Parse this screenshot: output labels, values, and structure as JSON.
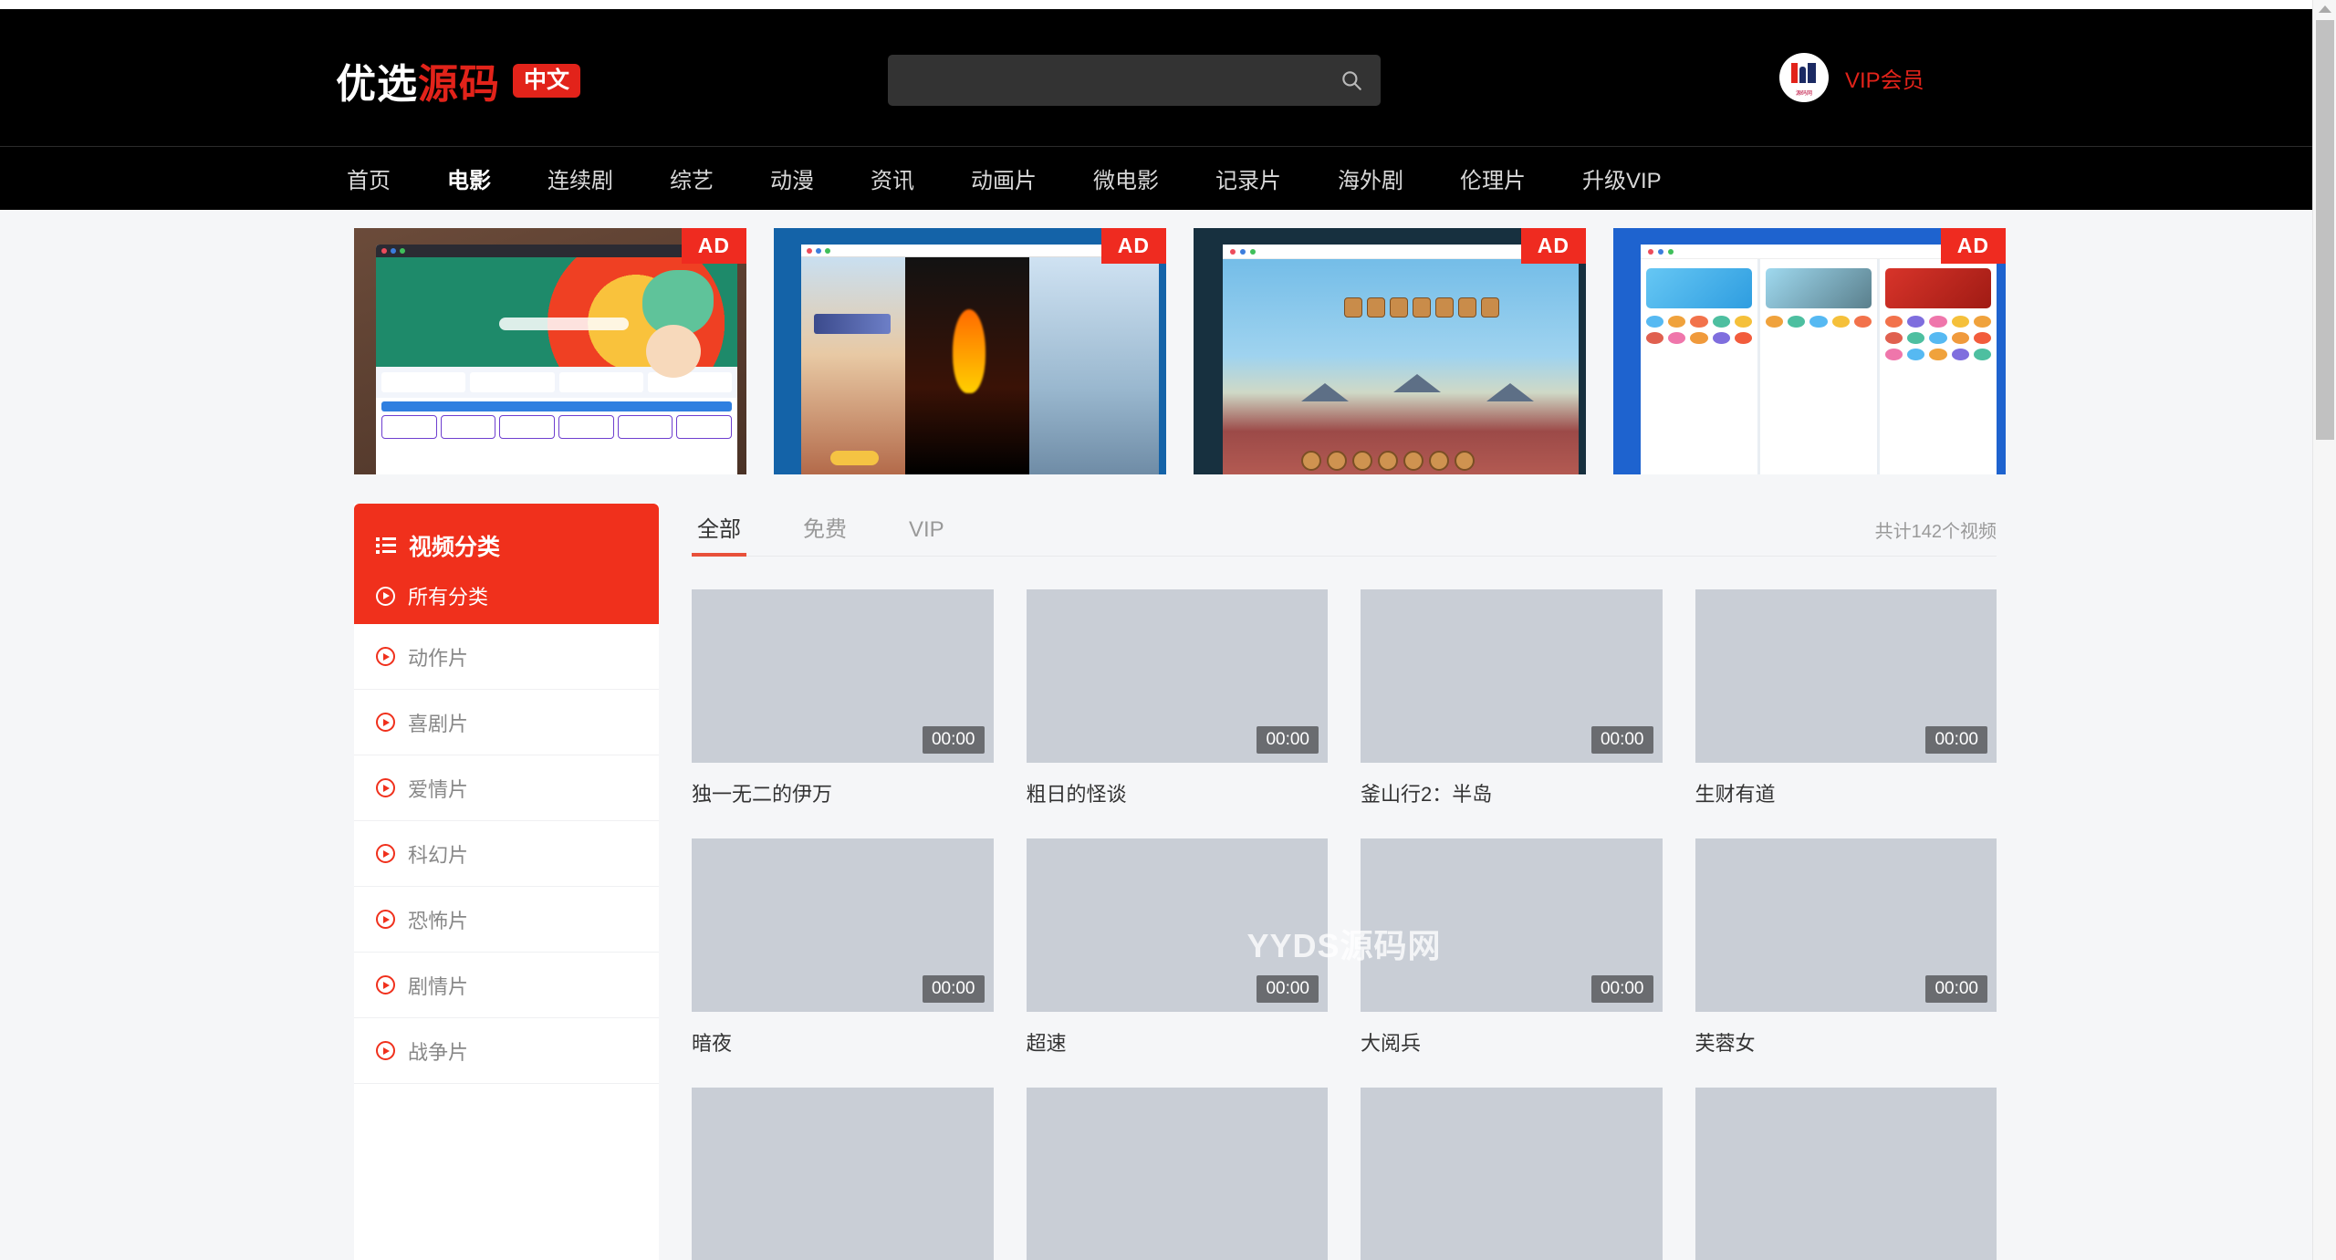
{
  "site": {
    "logo_part1": "优选",
    "logo_part2": "源码",
    "logo_badge": "中文"
  },
  "search": {
    "value": "",
    "placeholder": "",
    "icon": "search-icon"
  },
  "vip": {
    "label": "VIP会员",
    "avatar_text": "源码网"
  },
  "nav": {
    "items": [
      {
        "label": "首页",
        "active": false
      },
      {
        "label": "电影",
        "active": true
      },
      {
        "label": "连续剧",
        "active": false
      },
      {
        "label": "综艺",
        "active": false
      },
      {
        "label": "动漫",
        "active": false
      },
      {
        "label": "资讯",
        "active": false
      },
      {
        "label": "动画片",
        "active": false
      },
      {
        "label": "微电影",
        "active": false
      },
      {
        "label": "记录片",
        "active": false
      },
      {
        "label": "海外剧",
        "active": false
      },
      {
        "label": "伦理片",
        "active": false
      },
      {
        "label": "升级VIP",
        "active": false
      }
    ]
  },
  "ads": [
    {
      "badge": "AD",
      "name": "ad-banner-1"
    },
    {
      "badge": "AD",
      "name": "ad-banner-2"
    },
    {
      "badge": "AD",
      "name": "ad-banner-3"
    },
    {
      "badge": "AD",
      "name": "ad-banner-4"
    }
  ],
  "sidebar": {
    "title": "视频分类",
    "title_icon": "list-icon",
    "all_label": "所有分类",
    "items": [
      {
        "label": "动作片"
      },
      {
        "label": "喜剧片"
      },
      {
        "label": "爱情片"
      },
      {
        "label": "科幻片"
      },
      {
        "label": "恐怖片"
      },
      {
        "label": "剧情片"
      },
      {
        "label": "战争片"
      }
    ]
  },
  "main": {
    "tabs": [
      {
        "label": "全部",
        "active": true
      },
      {
        "label": "免费",
        "active": false
      },
      {
        "label": "VIP",
        "active": false
      }
    ],
    "total_text": "共计142个视频",
    "watermark": "YYDS源码网",
    "videos": [
      {
        "title": "独一无二的伊万",
        "duration": "00:00"
      },
      {
        "title": "粗日的怪谈",
        "duration": "00:00"
      },
      {
        "title": "釜山行2：半岛",
        "duration": "00:00"
      },
      {
        "title": "生财有道",
        "duration": "00:00"
      },
      {
        "title": "暗夜",
        "duration": "00:00"
      },
      {
        "title": "超速",
        "duration": "00:00"
      },
      {
        "title": "大阅兵",
        "duration": "00:00"
      },
      {
        "title": "芙蓉女",
        "duration": "00:00"
      },
      {
        "title": "",
        "duration": ""
      },
      {
        "title": "",
        "duration": ""
      },
      {
        "title": "",
        "duration": ""
      },
      {
        "title": "",
        "duration": ""
      }
    ]
  },
  "colors": {
    "brand_red": "#f0301c",
    "accent_red": "#e2231a",
    "tab_underline": "#e8503a",
    "header_bg": "#000000",
    "page_bg": "#f5f6f8",
    "thumb_placeholder": "#c9ced6"
  }
}
